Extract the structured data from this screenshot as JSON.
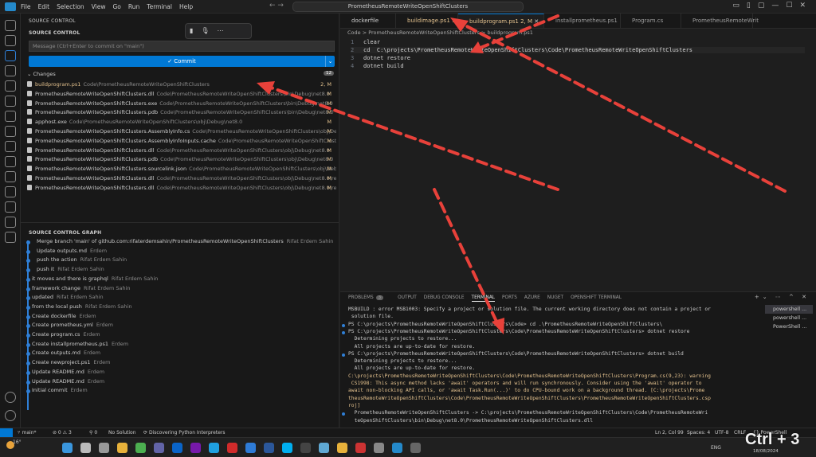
{
  "titlebar": {
    "menu": [
      "File",
      "Edit",
      "Selection",
      "View",
      "Go",
      "Run",
      "Terminal",
      "Help"
    ],
    "search": "PrometheusRemoteWriteOpenShiftClusters"
  },
  "sidebar": {
    "title": "SOURCE CONTROL",
    "section": "SOURCE CONTROL",
    "message_placeholder": "Message (Ctrl+Enter to commit on \"main\")",
    "commit_label": "✓ Commit",
    "changes_label": "Changes",
    "changes_count": "12",
    "changes": [
      {
        "name": "buildprogram.ps1",
        "path": "Code\\PrometheusRemoteWriteOpenShiftClusters",
        "status": "2, M"
      },
      {
        "name": "PrometheusRemoteWriteOpenShiftClusters.dll",
        "path": "Code\\PrometheusRemoteWriteOpenShiftClusters\\bin\\Debug\\net8.0",
        "status": "M"
      },
      {
        "name": "PrometheusRemoteWriteOpenShiftClusters.exe",
        "path": "Code\\PrometheusRemoteWriteOpenShiftClusters\\bin\\Debug\\net8.0",
        "status": "M"
      },
      {
        "name": "PrometheusRemoteWriteOpenShiftClusters.pdb",
        "path": "Code\\PrometheusRemoteWriteOpenShiftClusters\\bin\\Debug\\net8.0",
        "status": "M"
      },
      {
        "name": "apphost.exe",
        "path": "Code\\PrometheusRemoteWriteOpenShiftClusters\\obj\\Debug\\net8.0",
        "status": "M"
      },
      {
        "name": "PrometheusRemoteWriteOpenShiftClusters.AssemblyInfo.cs",
        "path": "Code\\PrometheusRemoteWriteOpenShiftClusters\\obj\\Debug\\...",
        "status": "M"
      },
      {
        "name": "PrometheusRemoteWriteOpenShiftClusters.AssemblyInfoInputs.cache",
        "path": "Code\\PrometheusRemoteWriteOpenShiftClusters\\obj\\Debug\\...",
        "status": "M"
      },
      {
        "name": "PrometheusRemoteWriteOpenShiftClusters.dll",
        "path": "Code\\PrometheusRemoteWriteOpenShiftClusters\\obj\\Debug\\net8.0",
        "status": "M"
      },
      {
        "name": "PrometheusRemoteWriteOpenShiftClusters.pdb",
        "path": "Code\\PrometheusRemoteWriteOpenShiftClusters\\obj\\Debug\\net8.0",
        "status": "M"
      },
      {
        "name": "PrometheusRemoteWriteOpenShiftClusters.sourcelink.json",
        "path": "Code\\PrometheusRemoteWriteOpenShiftClusters\\obj\\Debug\\...",
        "status": "M"
      },
      {
        "name": "PrometheusRemoteWriteOpenShiftClusters.dll",
        "path": "Code\\PrometheusRemoteWriteOpenShiftClusters\\obj\\Debug\\net8.0\\ref",
        "status": "M"
      },
      {
        "name": "PrometheusRemoteWriteOpenShiftClusters.dll",
        "path": "Code\\PrometheusRemoteWriteOpenShiftClusters\\obj\\Debug\\net8.0\\refint",
        "status": "M"
      }
    ],
    "graph_title": "SOURCE CONTROL GRAPH",
    "graph": [
      {
        "msg": "Merge branch 'main' of github.com:rifaterdemsahin/PrometheusRemoteWriteOpenShiftClusters",
        "author": "Rifat Erdem Sahin"
      },
      {
        "msg": "Update outputs.md",
        "author": "Erdem"
      },
      {
        "msg": "push the action",
        "author": "Rifat Erdem Sahin"
      },
      {
        "msg": "push it",
        "author": "Rifat Erdem Sahin"
      },
      {
        "msg": "it moves and there is graphql",
        "author": "Rifat Erdem Sahin"
      },
      {
        "msg": "framework change",
        "author": "Rifat Erdem Sahin"
      },
      {
        "msg": "updated",
        "author": "Rifat Erdem Sahin"
      },
      {
        "msg": "from the local push",
        "author": "Rifat Erdem Sahin"
      },
      {
        "msg": "Create dockerfile",
        "author": "Erdem"
      },
      {
        "msg": "Create prometheus.yml",
        "author": "Erdem"
      },
      {
        "msg": "Create program.cs",
        "author": "Erdem"
      },
      {
        "msg": "Create installprometheus.ps1",
        "author": "Erdem"
      },
      {
        "msg": "Create outputs.md",
        "author": "Erdem"
      },
      {
        "msg": "Create newproject.ps1",
        "author": "Erdem"
      },
      {
        "msg": "Update README.md",
        "author": "Erdem"
      },
      {
        "msg": "Update README.md",
        "author": "Erdem"
      },
      {
        "msg": "Initial commit",
        "author": "Erdem"
      }
    ]
  },
  "editor": {
    "tabs": [
      "dockerfile",
      "buildimage.ps1 1",
      "buildprogram.ps1 2, M",
      "installprometheus.ps1",
      "Program.cs",
      "PrometheusRemoteWrit"
    ],
    "breadcrumb": "Code > PrometheusRemoteWriteOpenShiftClusters > buildprogram.ps1",
    "lines": [
      {
        "n": "1",
        "t": "clear"
      },
      {
        "n": "2",
        "t": "cd  C:\\projects\\PrometheusRemoteWriteOpenShiftClusters\\Code\\PrometheusRemoteWriteOpenShiftClusters"
      },
      {
        "n": "3",
        "t": "dotnet restore"
      },
      {
        "n": "4",
        "t": "dotnet build"
      }
    ]
  },
  "panel": {
    "tabs": [
      "PROBLEMS",
      "OUTPUT",
      "DEBUG CONSOLE",
      "TERMINAL",
      "PORTS",
      "AZURE",
      "NUGET",
      "OPENSHIFT TERMINAL"
    ],
    "problems_count": "3",
    "terminal": [
      {
        "t": "MSBUILD : error MSB1003: Specify a project or solution file. The current working directory does not contain a project or",
        "w": false
      },
      {
        "t": " solution file.",
        "w": false
      },
      {
        "t": "PS C:\\projects\\PrometheusRemoteWriteOpenShiftClusters\\Code> cd .\\PrometheusRemoteWriteOpenShiftClusters\\",
        "w": false
      },
      {
        "t": "PS C:\\projects\\PrometheusRemoteWriteOpenShiftClusters\\Code\\PrometheusRemoteWriteOpenShiftClusters> dotnet restore",
        "w": false
      },
      {
        "t": "  Determining projects to restore...",
        "w": false
      },
      {
        "t": "  All projects are up-to-date for restore.",
        "w": false
      },
      {
        "t": "PS C:\\projects\\PrometheusRemoteWriteOpenShiftClusters\\Code\\PrometheusRemoteWriteOpenShiftClusters> dotnet build",
        "w": false
      },
      {
        "t": "  Determining projects to restore...",
        "w": false
      },
      {
        "t": "  All projects are up-to-date for restore.",
        "w": false
      },
      {
        "t": "C:\\projects\\PrometheusRemoteWriteOpenShiftClusters\\Code\\PrometheusRemoteWriteOpenShiftClusters\\Program.cs(9,23): warning",
        "w": true
      },
      {
        "t": " CS1998: This async method lacks 'await' operators and will run synchronously. Consider using the 'await' operator to",
        "w": true
      },
      {
        "t": "await non-blocking API calls, or 'await Task.Run(...)' to do CPU-bound work on a background thread. [C:\\projects\\Prome",
        "w": true
      },
      {
        "t": "theusRemoteWriteOpenShiftClusters\\Code\\PrometheusRemoteWriteOpenShiftClusters\\PrometheusRemoteWriteOpenShiftClusters.csp",
        "w": true
      },
      {
        "t": "roj]",
        "w": true
      },
      {
        "t": "  PrometheusRemoteWriteOpenShiftClusters -> C:\\projects\\PrometheusRemoteWriteOpenShiftClusters\\Code\\PrometheusRemoteWri",
        "w": false
      },
      {
        "t": "  teOpenShiftClusters\\bin\\Debug\\net8.0\\PrometheusRemoteWriteOpenShiftClusters.dll",
        "w": false
      }
    ],
    "terminals": [
      "powershell ...",
      "powershell ...",
      "PowerShell ..."
    ]
  },
  "status": {
    "branch": "main*",
    "sync": "⊘ 0 ⚠ 3",
    "zero": "0",
    "solution": "No Solution",
    "discover": "Discovering Python Interpreters",
    "ln": "Ln 2, Col 99",
    "spaces": "Spaces: 4",
    "enc": "UTF-8",
    "eol": "CRLF",
    "lang": "PowerShell"
  },
  "taskbar": {
    "weather": "16°",
    "lang": "ENG",
    "date": "18/08/2024"
  },
  "overlay": {
    "shortcut": "Ctrl + 3"
  }
}
